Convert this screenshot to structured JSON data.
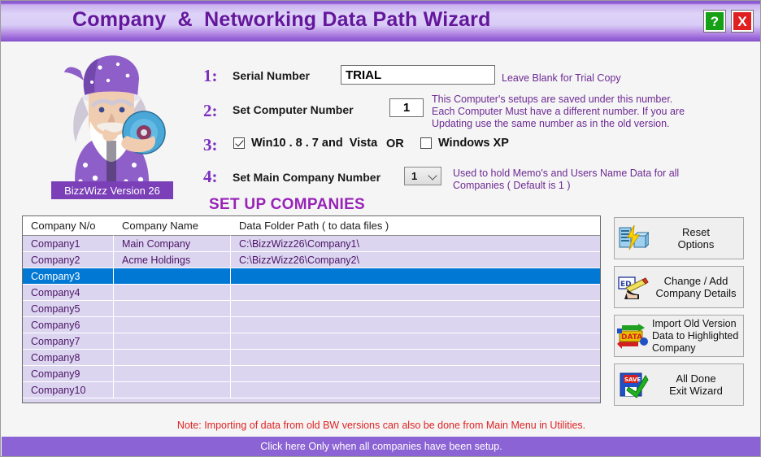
{
  "window": {
    "title": "Company  &  Networking Data Path Wizard",
    "help_label": "?",
    "close_label": "X"
  },
  "wizard": {
    "caption": "BizzWizz Version 26"
  },
  "steps": {
    "step1": {
      "number": "1:",
      "label": "Serial Number",
      "value": "TRIAL",
      "hint": "Leave Blank for Trial Copy"
    },
    "step2": {
      "number": "2:",
      "label": "Set Computer Number",
      "value": "1",
      "hint": "This Computer's setups are saved under this number.\nEach Computer Must have a different number. If you are\nUpdating use the same number as in the old version."
    },
    "step3": {
      "number": "3:",
      "option_win10": "Win10 . 8 . 7 and  Vista",
      "or_text": "OR",
      "option_winxp": "Windows XP"
    },
    "step4": {
      "number": "4:",
      "label": "Set Main Company Number",
      "value": "1",
      "hint": "Used to hold Memo's and Users Name Data for all\nCompanies ( Default is 1 )"
    }
  },
  "section_heading": "SET UP COMPANIES",
  "table": {
    "columns": [
      "Company N/o",
      "Company Name",
      "Data Folder Path ( to data files )"
    ],
    "rows": [
      {
        "no": "Company1",
        "name": "Main Company",
        "path": "C:\\BizzWizz26\\Company1\\",
        "selected": false
      },
      {
        "no": "Company2",
        "name": "Acme Holdings",
        "path": "C:\\BizzWizz26\\Company2\\",
        "selected": false
      },
      {
        "no": "Company3",
        "name": "",
        "path": "",
        "selected": true
      },
      {
        "no": "Company4",
        "name": "",
        "path": "",
        "selected": false
      },
      {
        "no": "Company5",
        "name": "",
        "path": "",
        "selected": false
      },
      {
        "no": "Company6",
        "name": "",
        "path": "",
        "selected": false
      },
      {
        "no": "Company7",
        "name": "",
        "path": "",
        "selected": false
      },
      {
        "no": "Company8",
        "name": "",
        "path": "",
        "selected": false
      },
      {
        "no": "Company9",
        "name": "",
        "path": "",
        "selected": false
      },
      {
        "no": "Company10",
        "name": "",
        "path": "",
        "selected": false
      }
    ]
  },
  "buttons": {
    "reset_options": "Reset\nOptions",
    "change_company": "Change / Add\nCompany Details",
    "import_data": "Import Old Version\nData to Highlighted\nCompany",
    "all_done": "All  Done\nExit Wizard"
  },
  "footer": {
    "note": "Note: Importing of data from old BW versions can also be done from Main Menu in Utilities.",
    "status": "Click here Only when all companies have been setup."
  },
  "colors": {
    "title_text": "#64179b",
    "accent_purple": "#7b2fbe",
    "heading_magenta": "#9823b7",
    "hint_purple": "#6d2a93",
    "selection_blue": "#0078d4",
    "row_lavender": "#dcd5f0",
    "note_red": "#e02222",
    "status_bar": "#8c63d4"
  }
}
